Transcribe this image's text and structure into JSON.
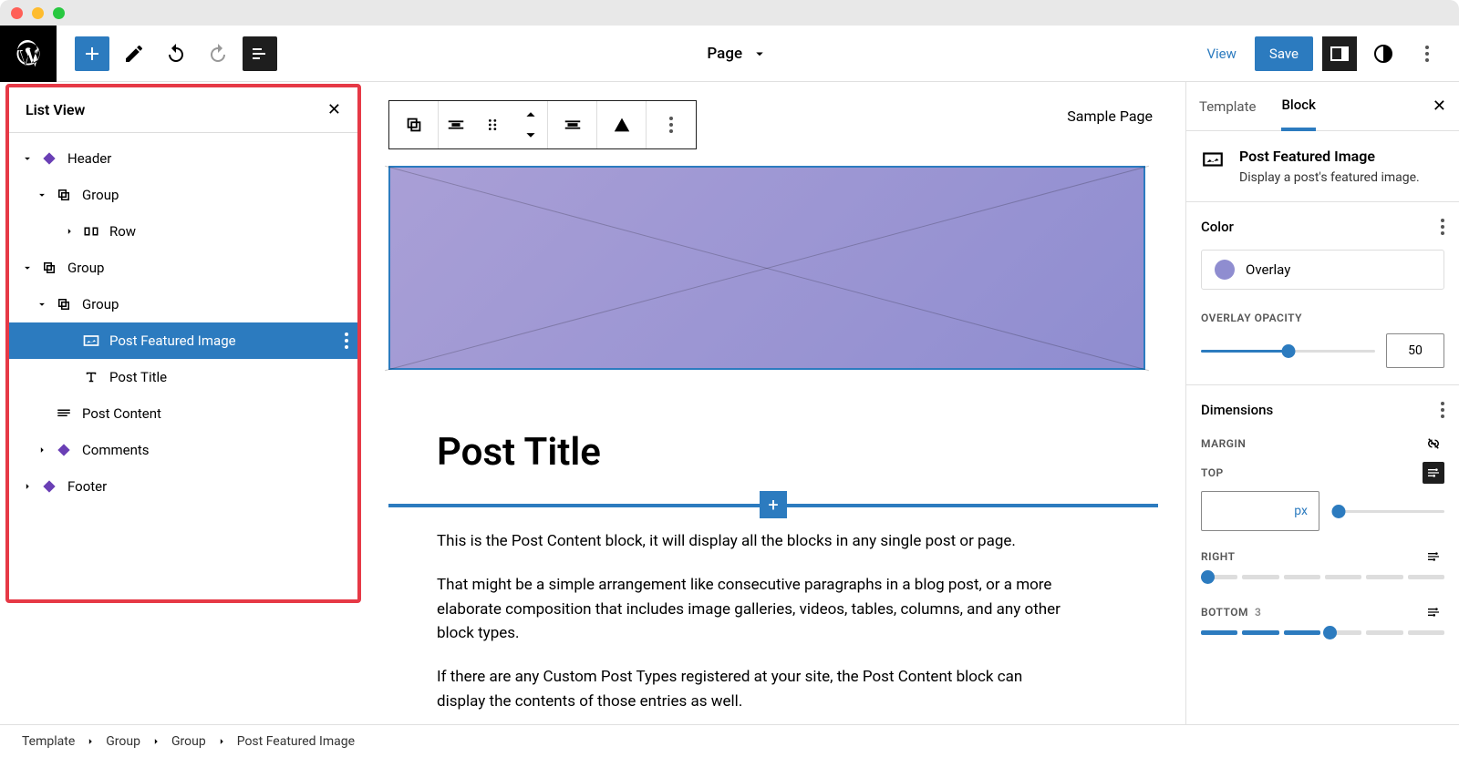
{
  "appbar": {
    "title": "Page",
    "view_label": "View",
    "save_label": "Save"
  },
  "canvas": {
    "top_link": "Sample Page",
    "post_title": "Post Title",
    "para1": "This is the Post Content block, it will display all the blocks in any single post or page.",
    "para2": "That might be a simple arrangement like consecutive paragraphs in a blog post, or a more elaborate composition that includes image galleries, videos, tables, columns, and any other block types.",
    "para3": "If there are any Custom Post Types registered at your site, the Post Content block can display the contents of those entries as well."
  },
  "listview": {
    "title": "List View",
    "items": {
      "header": "Header",
      "group1": "Group",
      "row": "Row",
      "group2": "Group",
      "group3": "Group",
      "pfi": "Post Featured Image",
      "pt": "Post Title",
      "pc": "Post Content",
      "comments": "Comments",
      "footer": "Footer"
    }
  },
  "inspector": {
    "tab_template": "Template",
    "tab_block": "Block",
    "block": {
      "name": "Post Featured Image",
      "desc": "Display a post's featured image."
    },
    "color": {
      "title": "Color",
      "overlay_label": "Overlay",
      "opacity_label": "Overlay Opacity",
      "opacity_value": "50"
    },
    "dimensions": {
      "title": "Dimensions",
      "margin_label": "Margin",
      "top_label": "Top",
      "unit": "px",
      "right_label": "Right",
      "bottom_label": "Bottom",
      "bottom_value": "3"
    }
  },
  "breadcrumb": {
    "a": "Template",
    "b": "Group",
    "c": "Group",
    "d": "Post Featured Image"
  }
}
